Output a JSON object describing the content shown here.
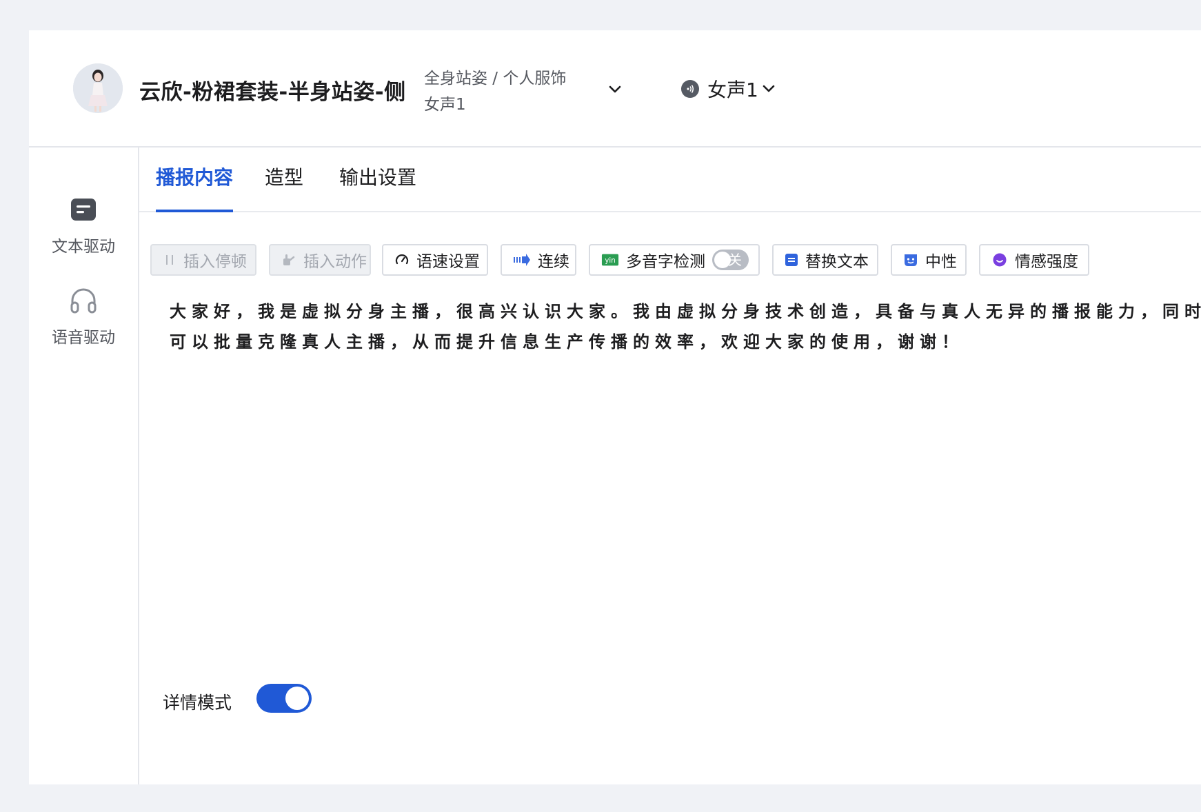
{
  "header": {
    "title": "云欣-粉裙套装-半身站姿-侧",
    "meta_line1": "全身站姿 / 个人服饰",
    "meta_line2": "女声1",
    "voice_label": "女声1"
  },
  "rail": {
    "items": [
      {
        "label": "文本驱动",
        "icon": "text-drive-icon"
      },
      {
        "label": "语音驱动",
        "icon": "headphones-icon"
      }
    ]
  },
  "tabs": [
    {
      "label": "播报内容",
      "active": true
    },
    {
      "label": "造型",
      "active": false
    },
    {
      "label": "输出设置",
      "active": false
    }
  ],
  "toolbar": {
    "insert_pause": "插入停顿",
    "insert_action": "插入动作",
    "speed_settings": "语速设置",
    "continuous": "连续",
    "polyphone_check": "多音字检测",
    "polyphone_toggle_label": "关",
    "replace_text": "替换文本",
    "neutral": "中性",
    "emotion_strength": "情感强度"
  },
  "content": {
    "line1": "大家好，我是虚拟分身主播，很高兴认识大家。我由虚拟分身技术创造，具备与真人无异的播报能力，同时",
    "line2": "可以批量克隆真人主播，从而提升信息生产传播的效率，欢迎大家的使用，谢谢！"
  },
  "detail_mode": {
    "label": "详情模式",
    "enabled": true
  },
  "colors": {
    "accent": "#2059d6",
    "page_bg": "#f0f2f6",
    "border": "#e4e6eb"
  }
}
